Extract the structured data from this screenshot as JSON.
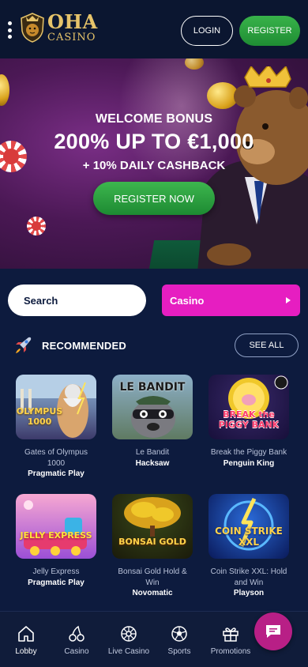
{
  "header": {
    "logo_line1": "OHA",
    "logo_line2": "CASINO",
    "login_label": "LOGIN",
    "register_label": "REGISTER"
  },
  "banner": {
    "line1": "WELCOME BONUS",
    "line2": "200% UP TO €1,000",
    "line3": "+ 10% DAILY CASHBACK",
    "cta_label": "REGISTER NOW"
  },
  "search": {
    "placeholder": "Search",
    "value": ""
  },
  "category_select": {
    "selected": "Casino"
  },
  "recommended": {
    "title": "RECOMMENDED",
    "see_all_label": "SEE ALL",
    "games": [
      {
        "name": "Gates of Olympus 1000",
        "provider": "Pragmatic Play",
        "thumb_text": "OLYMPUS 1000"
      },
      {
        "name": "Le Bandit",
        "provider": "Hacksaw",
        "thumb_text": "LE BANDIT"
      },
      {
        "name": "Break the Piggy Bank",
        "provider": "Penguin King",
        "thumb_text": "BREAK the PIGGY BANK"
      },
      {
        "name": "Jelly Express",
        "provider": "Pragmatic Play",
        "thumb_text": "JELLY EXPRESS"
      },
      {
        "name": "Bonsai Gold Hold & Win",
        "provider": "Novomatic",
        "thumb_text": "BONSAI GOLD"
      },
      {
        "name": "Coin Strike XXL: Hold and Win",
        "provider": "Playson",
        "thumb_text": "COIN STRIKE XXL"
      }
    ]
  },
  "bottom_nav": {
    "items": [
      {
        "label": "Lobby",
        "icon": "home-icon"
      },
      {
        "label": "Casino",
        "icon": "cherry-icon"
      },
      {
        "label": "Live Casino",
        "icon": "roulette-icon"
      },
      {
        "label": "Sports",
        "icon": "soccer-ball-icon"
      },
      {
        "label": "Promotions",
        "icon": "gift-icon"
      }
    ],
    "active": "Lobby"
  },
  "colors": {
    "background": "#0d1b3e",
    "accent_green": "#2ea043",
    "accent_magenta": "#e61ec1",
    "gold": "#e7c46a"
  }
}
